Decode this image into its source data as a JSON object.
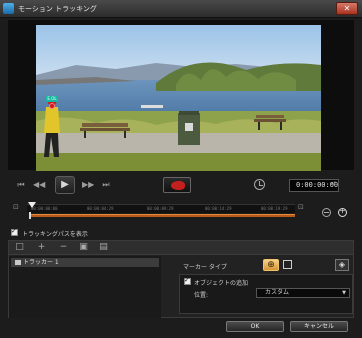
{
  "window": {
    "title": "モーション トラッキング",
    "close_glyph": "✕"
  },
  "video": {
    "tracker_label": "E.OL"
  },
  "playback": {
    "rewind_start": "⏮",
    "prev_frame": "◀◀",
    "play": "▶",
    "next_frame": "▶▶",
    "forward_end": "⏭",
    "timecode": "0:00:00:00",
    "timecode_spin": "▲▼"
  },
  "timeline": {
    "ticks": [
      "00:00:00:00",
      "00:00:04:29",
      "00:00:09:29",
      "00:00:14:29",
      "00:00:19:29"
    ],
    "zoom_label_left": "⊖",
    "ruler_left": "⊡",
    "ruler_right": "⊡"
  },
  "options": {
    "show_track_label": "トラッキングパスを表示",
    "show_track_checked": true
  },
  "panel": {
    "toolbar_icons": [
      "□",
      "+",
      "−",
      "▣",
      "▤"
    ],
    "list_items": [
      {
        "label": "トラッカー 1"
      }
    ],
    "marker_type_label": "マーカー タイプ",
    "marker_btn_1": "⊕",
    "marker_btn_3": "◈",
    "obj_check_label": "オブジェクトの追加",
    "obj_check_checked": true,
    "position_label": "位置:",
    "position_value": "カスタム",
    "position_caret": "▼"
  },
  "footer": {
    "ok_label": "OK",
    "cancel_label": "キャンセル"
  }
}
